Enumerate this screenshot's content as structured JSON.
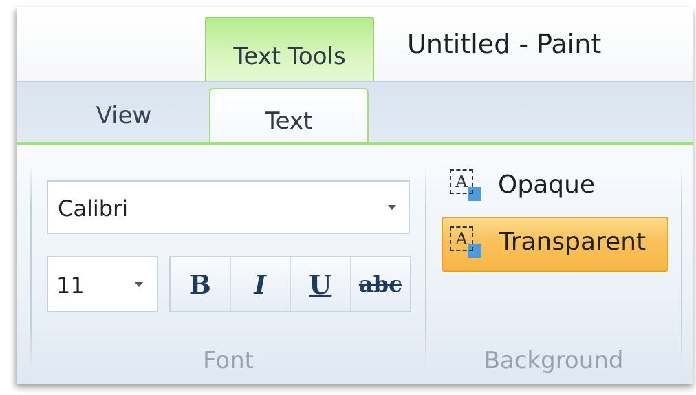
{
  "window": {
    "title": "Untitled - Paint",
    "context_tab": "Text Tools"
  },
  "tabs": {
    "view": "View",
    "text": "Text"
  },
  "font_group": {
    "font_name": "Calibri",
    "font_size": "11",
    "bold_glyph": "B",
    "italic_glyph": "I",
    "underline_glyph": "U",
    "strikethrough_glyph": "abc",
    "label": "Font"
  },
  "background_group": {
    "opaque_label": "Opaque",
    "transparent_label": "Transparent",
    "icon_glyph": "A",
    "selected": "Transparent",
    "label": "Background"
  },
  "colors": {
    "context_accent": "#9ee07a",
    "selection_highlight": "#f9c15a"
  }
}
